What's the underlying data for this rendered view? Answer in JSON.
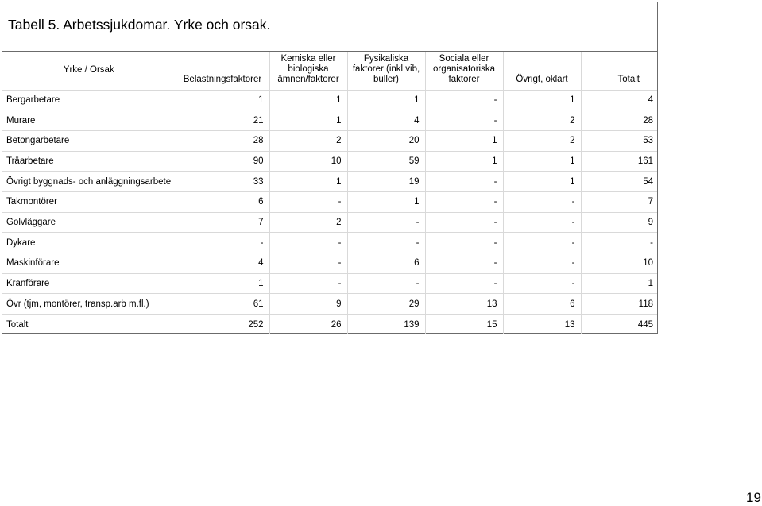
{
  "title": "Tabell 5. Arbetssjukdomar. Yrke och orsak.",
  "table": {
    "corner_header": "Yrke / Orsak",
    "columns": [
      "Belastningsfaktorer",
      "Kemiska eller biologiska ämnen/faktorer",
      "Fysikaliska faktorer (inkl vib, buller)",
      "Sociala eller organisatoriska faktorer",
      "Övrigt, oklart",
      "Totalt"
    ],
    "rows": [
      {
        "label": "Bergarbetare",
        "values": [
          "1",
          "1",
          "1",
          "-",
          "1",
          "4"
        ]
      },
      {
        "label": "Murare",
        "values": [
          "21",
          "1",
          "4",
          "-",
          "2",
          "28"
        ]
      },
      {
        "label": "Betongarbetare",
        "values": [
          "28",
          "2",
          "20",
          "1",
          "2",
          "53"
        ]
      },
      {
        "label": "Träarbetare",
        "values": [
          "90",
          "10",
          "59",
          "1",
          "1",
          "161"
        ]
      },
      {
        "label": "Övrigt byggnads- och anläggningsarbete",
        "values": [
          "33",
          "1",
          "19",
          "-",
          "1",
          "54"
        ]
      },
      {
        "label": "Takmontörer",
        "values": [
          "6",
          "-",
          "1",
          "-",
          "-",
          "7"
        ]
      },
      {
        "label": "Golvläggare",
        "values": [
          "7",
          "2",
          "-",
          "-",
          "-",
          "9"
        ]
      },
      {
        "label": "Dykare",
        "values": [
          "-",
          "-",
          "-",
          "-",
          "-",
          "-"
        ]
      },
      {
        "label": "Maskinförare",
        "values": [
          "4",
          "-",
          "6",
          "-",
          "-",
          "10"
        ]
      },
      {
        "label": "Kranförare",
        "values": [
          "1",
          "-",
          "-",
          "-",
          "-",
          "1"
        ]
      },
      {
        "label": "Övr (tjm, montörer, transp.arb m.fl.)",
        "values": [
          "61",
          "9",
          "29",
          "13",
          "6",
          "118"
        ]
      },
      {
        "label": "Totalt",
        "values": [
          "252",
          "26",
          "139",
          "15",
          "13",
          "445"
        ]
      }
    ]
  },
  "page_number": "19"
}
